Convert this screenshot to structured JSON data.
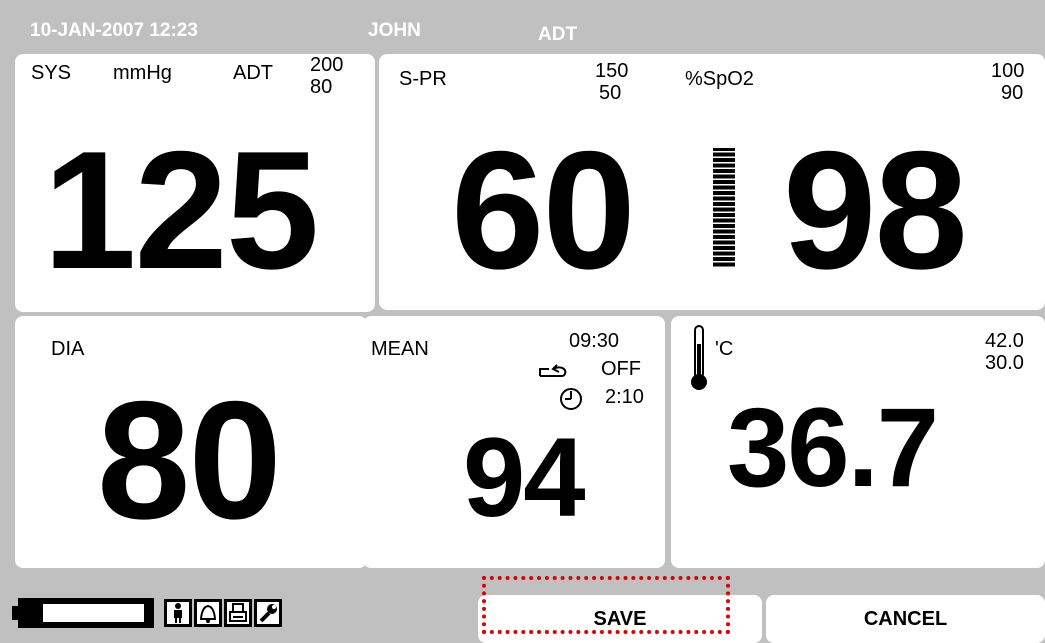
{
  "header": {
    "datetime": "10-JAN-2007 12:23",
    "patient": "JOHN",
    "mode": "ADT"
  },
  "sys": {
    "label": "SYS",
    "unit": "mmHg",
    "mode": "ADT",
    "high": "200",
    "low": "80",
    "value": "125"
  },
  "spr": {
    "label": "S-PR",
    "high": "150",
    "low": "50",
    "value": "60"
  },
  "spo2": {
    "label": "%SpO2",
    "high": "100",
    "low": "90",
    "value": "98",
    "signal_bar_level": 1.0
  },
  "dia": {
    "label": "DIA",
    "value": "80"
  },
  "mean": {
    "label": "MEAN",
    "time": "09:30",
    "auto_state": "OFF",
    "timer": "2:10",
    "value": "94"
  },
  "temp": {
    "unit": "'C",
    "high": "42.0",
    "low": "30.0",
    "value": "36.7"
  },
  "bottom": {
    "battery_level": 0.15,
    "save_label": "SAVE",
    "cancel_label": "CANCEL"
  },
  "icons": [
    "patient-icon",
    "alarm-bell-icon",
    "printer-icon",
    "wrench-icon"
  ],
  "colors": {
    "background": "#c0c0c0",
    "panel": "#ffffff",
    "focus": "#e00000"
  }
}
